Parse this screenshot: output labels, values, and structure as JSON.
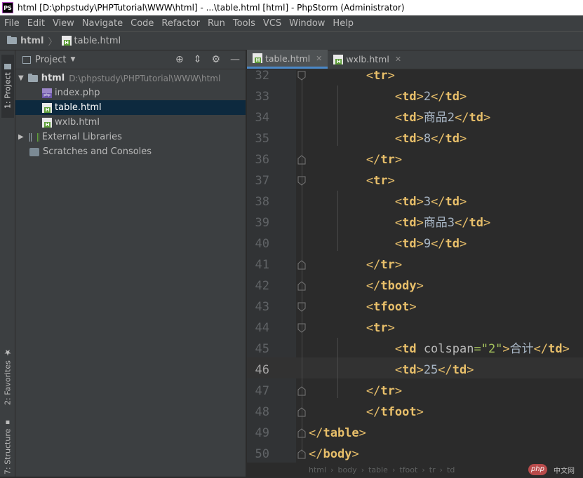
{
  "window": {
    "title": "html [D:\\phpstudy\\PHPTutorial\\WWW\\html] - ...\\table.html [html] - PhpStorm (Administrator)",
    "app_icon": "PS"
  },
  "menu": [
    "File",
    "Edit",
    "View",
    "Navigate",
    "Code",
    "Refactor",
    "Run",
    "Tools",
    "VCS",
    "Window",
    "Help"
  ],
  "nav": {
    "folder": "html",
    "file": "table.html"
  },
  "side_tabs": {
    "project": "1: Project",
    "favorites": "2: Favorites",
    "structure": "7: Structure"
  },
  "project": {
    "title": "Project",
    "root": {
      "name": "html",
      "path": "D:\\phpstudy\\PHPTutorial\\WWW\\html"
    },
    "files": [
      "index.php",
      "table.html",
      "wxlb.html"
    ],
    "external": "External Libraries",
    "scratches": "Scratches and Consoles"
  },
  "tabs": [
    {
      "label": "table.html",
      "active": true
    },
    {
      "label": "wxlb.html",
      "active": false
    }
  ],
  "code": {
    "line_numbers": [
      "32",
      "33",
      "34",
      "35",
      "36",
      "37",
      "38",
      "39",
      "40",
      "41",
      "42",
      "43",
      "44",
      "45",
      "46",
      "47",
      "48",
      "49",
      "50"
    ],
    "current_line": "46"
  },
  "breadcrumb": [
    "html",
    "body",
    "table",
    "tfoot",
    "tr",
    "td"
  ],
  "watermark": {
    "logo": "php",
    "text": "中文网"
  }
}
